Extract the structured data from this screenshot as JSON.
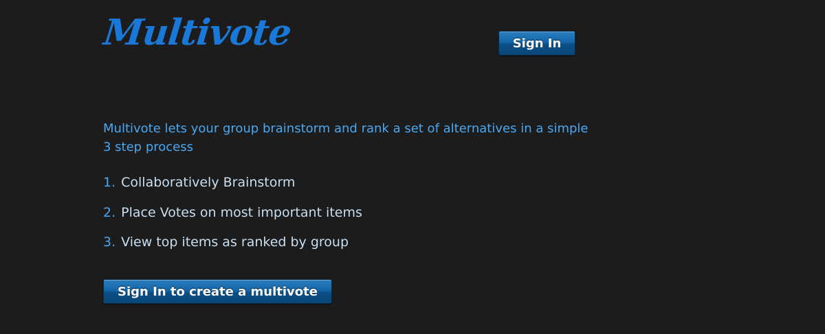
{
  "header": {
    "logo_text": "Multivote",
    "sign_in_label": "Sign In"
  },
  "colors": {
    "background": "#1c1c1c",
    "logo": "#1a78d8",
    "intro_text": "#4aa8f2",
    "step_text": "#c8dff2",
    "button": "#1466a8"
  },
  "main": {
    "intro": "Multivote lets your group brainstorm and rank a set of alternatives in a simple 3 step process",
    "steps": [
      {
        "number": "1.",
        "text": "Collaboratively Brainstorm"
      },
      {
        "number": "2.",
        "text": "Place Votes on most important items"
      },
      {
        "number": "3.",
        "text": "View top items as ranked by group"
      }
    ],
    "cta_label": "Sign In to create a multivote"
  }
}
